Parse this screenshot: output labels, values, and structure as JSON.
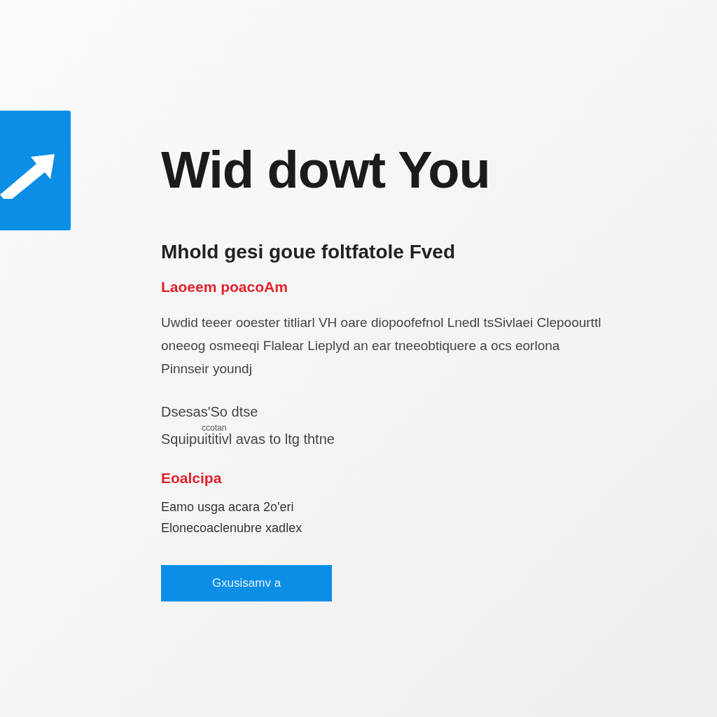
{
  "title": "Wid dowt You",
  "subtitle": "Mhold gesi goue foltfatole Fved",
  "alert": "Laoeem poacoAm",
  "paragraph_lines": [
    "Uwdid teeer ooester titliarl VH oare diopoofefnol Lnedl tsSivlaei Clepoourttl",
    "oneeog osmeeqi Flalear Lieplyd an ear tneeobtiquere a ocs eorlona",
    "Pinnseir youndj"
  ],
  "detail": {
    "label": "Dsesas'So dtse",
    "note": "ccotan",
    "line": "Squipuititivl avas to ltg thtne"
  },
  "section_heading": "Eoalcipa",
  "section_lines": [
    "Eamo usga acara 2o'eri",
    "Elonecoaclenubre xadlex"
  ],
  "button": "Gxusisamv a"
}
